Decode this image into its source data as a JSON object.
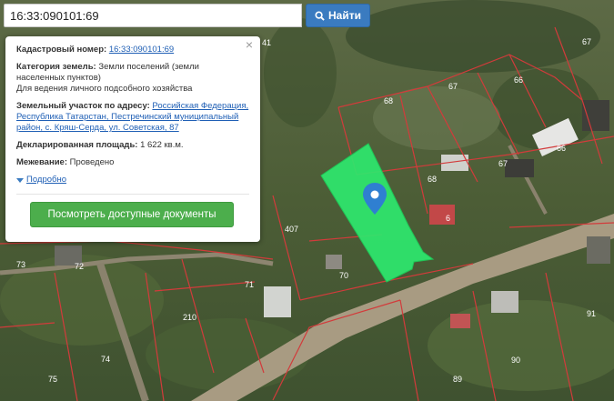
{
  "search": {
    "value": "16:33:090101:69",
    "button_label": "Найти"
  },
  "popup": {
    "close_glyph": "×",
    "cadastral_label": "Кадастровый номер:",
    "cadastral_value": "16:33:090101:69",
    "category_label": "Категория земель:",
    "category_value": "Земли поселений (земли населенных пунктов)",
    "usage": "Для ведения личного подсобного хозяйства",
    "address_label": "Земельный участок по адресу:",
    "address_value": "Российская Федерация, Республика Татарстан, Пестречинский муниципальный район, с. Кряш-Серда, ул. Советская, 87",
    "area_label": "Декларированная площадь:",
    "area_value": "1 622 кв.м.",
    "survey_label": "Межевание:",
    "survey_value": "Проведено",
    "more_label": "Подробно",
    "docs_button": "Посмотреть доступные документы"
  },
  "map": {
    "parcel_labels": [
      "41",
      "67",
      "66",
      "68",
      "67",
      "66",
      "68",
      "407",
      "70",
      "71",
      "73",
      "72",
      "210",
      "74",
      "75",
      "90",
      "89",
      "91",
      "6"
    ],
    "highlight_color": "#2ee86e",
    "boundary_color": "#d23b3b",
    "marker_color": "#2f7fd1"
  }
}
